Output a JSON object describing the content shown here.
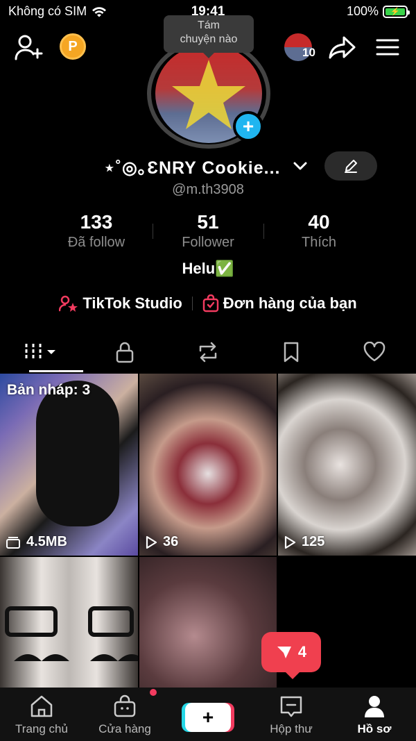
{
  "status_bar": {
    "carrier": "Không có SIM",
    "time": "19:41",
    "battery": "100%"
  },
  "tooltip": "Tám\nchuyện nào",
  "profile": {
    "display_name": "⋆˚◎｡ƐNRY Cookie...",
    "username": "@m.th3908",
    "stats": [
      {
        "value": "133",
        "label": "Đã follow"
      },
      {
        "value": "51",
        "label": "Follower"
      },
      {
        "value": "40",
        "label": "Thích"
      }
    ],
    "bio": "Helu✅",
    "friends_count": "10"
  },
  "links": {
    "studio": "TikTok Studio",
    "orders": "Đơn hàng của bạn"
  },
  "videos": [
    {
      "overlay": "Bản nháp: 3",
      "meta": "4.5MB",
      "kind": "draft"
    },
    {
      "meta": "36",
      "kind": "views"
    },
    {
      "meta": "125",
      "kind": "views"
    }
  ],
  "inbox_bubble_count": "4",
  "bottom_nav": [
    {
      "label": "Trang chủ"
    },
    {
      "label": "Cửa hàng"
    },
    {
      "label": "+"
    },
    {
      "label": "Hộp thư"
    },
    {
      "label": "Hồ sơ"
    }
  ],
  "colors": {
    "accent_red": "#f23b5f",
    "accent_cyan": "#25d7e6",
    "badge_blue": "#20b5f0",
    "coin_orange": "#f5a623"
  }
}
